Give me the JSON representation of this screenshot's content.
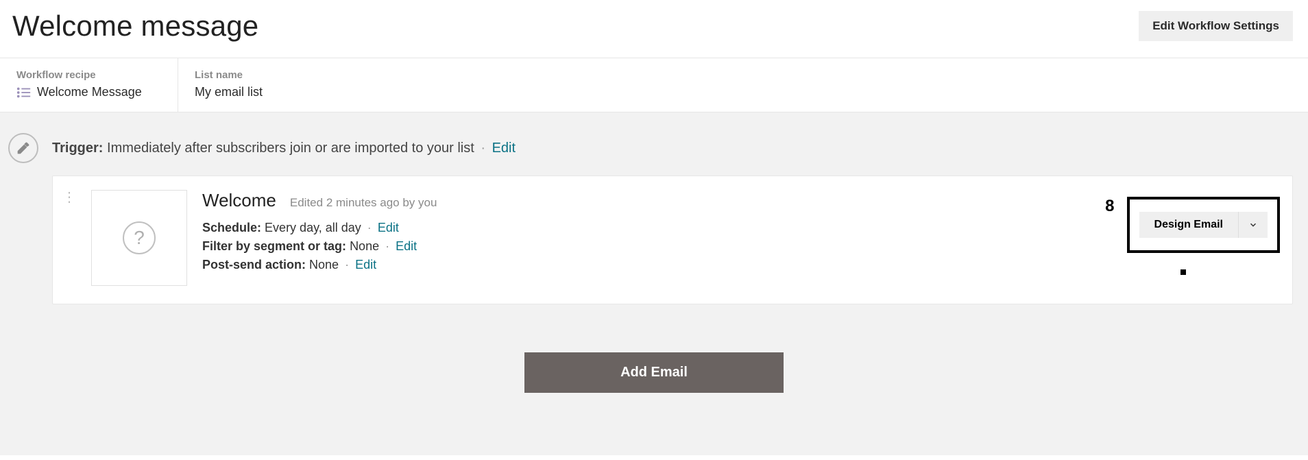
{
  "header": {
    "title": "Welcome message",
    "settings_button": "Edit Workflow Settings"
  },
  "meta": {
    "recipe_label": "Workflow recipe",
    "recipe_value": "Welcome Message",
    "list_label": "List name",
    "list_value": "My email list"
  },
  "trigger": {
    "prefix": "Trigger:",
    "text": "Immediately after subscribers join or are imported to your list",
    "edit": "Edit"
  },
  "email": {
    "title": "Welcome",
    "edited_prefix": "Edited ",
    "edited_text": "2 minutes ago by you",
    "schedule_label": "Schedule:",
    "schedule_value": "Every day, all day",
    "filter_label": "Filter by segment or tag:",
    "filter_value": "None",
    "postsend_label": "Post-send action:",
    "postsend_value": "None",
    "edit": "Edit",
    "design_button": "Design Email",
    "annotation_number": "8"
  },
  "add_email_button": "Add Email"
}
